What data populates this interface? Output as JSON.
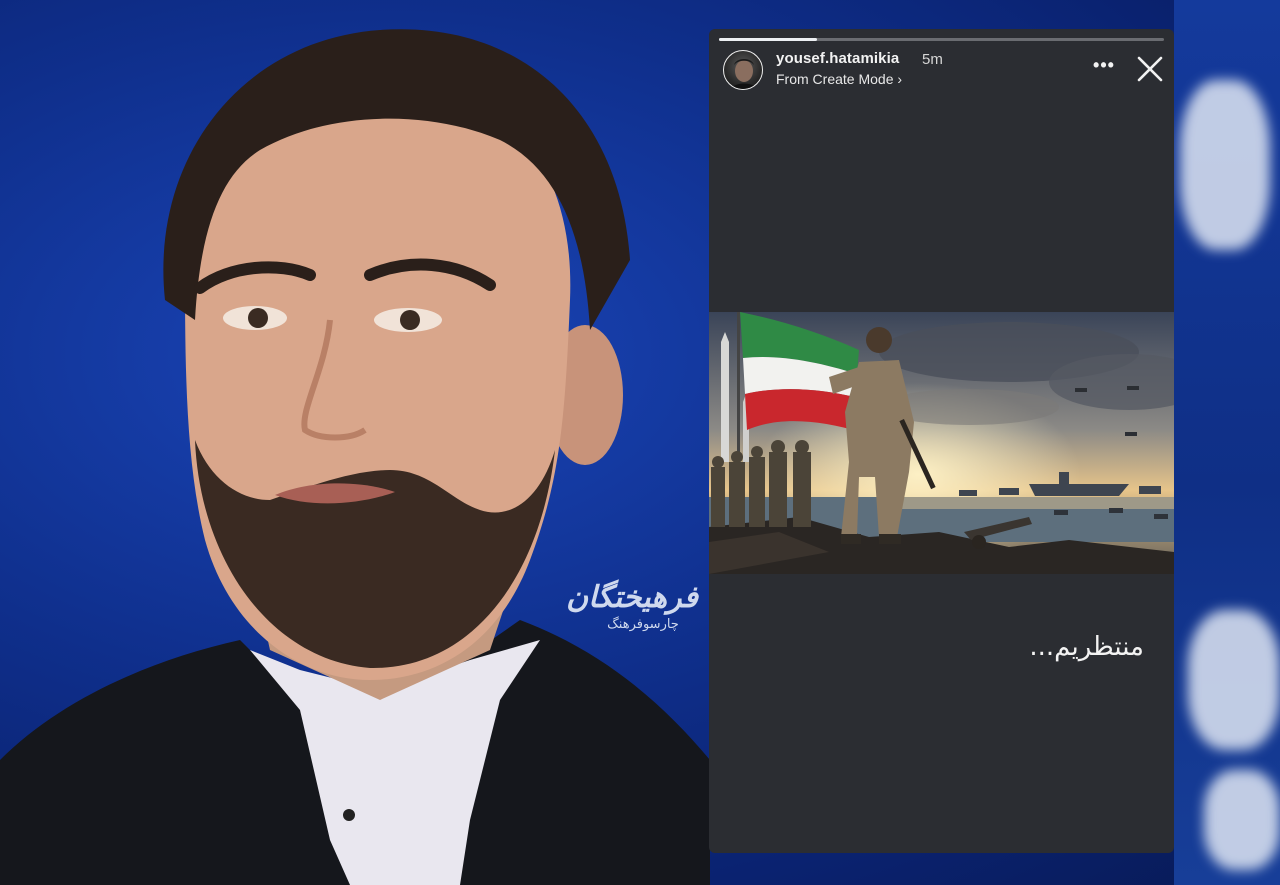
{
  "story": {
    "username": "yousef.hatamikia",
    "time_ago": "5m",
    "subtitle": "From Create Mode",
    "more_label": "•••",
    "caption": "منتظریم...",
    "progress_fraction": 0.22
  },
  "watermark": {
    "main": "فرهیختگان",
    "sub": "چارسوفرهنگ"
  },
  "icons": {
    "more": "more-icon",
    "close": "close-icon",
    "chevron": "chevron-right-icon"
  },
  "colors": {
    "panel_bg": "#2b2d32",
    "backdrop_blue": "#0f2f8c",
    "text_primary": "#f2f2f2"
  }
}
